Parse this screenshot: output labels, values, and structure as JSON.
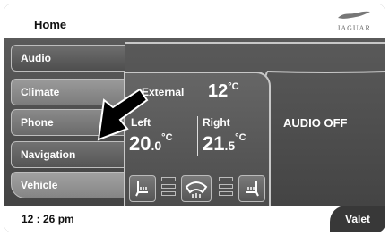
{
  "header": {
    "title": "Home",
    "brand": "JAGUAR"
  },
  "nav": [
    {
      "key": "audio",
      "label": "Audio"
    },
    {
      "key": "climate",
      "label": "Climate"
    },
    {
      "key": "phone",
      "label": "Phone"
    },
    {
      "key": "navigation",
      "label": "Navigation"
    },
    {
      "key": "vehicle",
      "label": "Vehicle"
    }
  ],
  "climate": {
    "external_label": "External",
    "external_value": "12",
    "external_unit": "°C",
    "left_label": "Left",
    "right_label": "Right",
    "left_temp_int": "20",
    "left_temp_dec": ".0",
    "right_temp_int": "21",
    "right_temp_dec": ".5",
    "unit": "°C"
  },
  "audio_status": "AUDIO OFF",
  "footer": {
    "time": "12 : 26 pm",
    "valet_label": "Valet"
  },
  "colors": {
    "panel": "#4a4a4a",
    "outline": "#c8c8c8",
    "text": "#ffffff"
  },
  "icons": [
    "jaguar-leaper-icon",
    "pointer-arrow-icon",
    "seat-heater-icon",
    "defrost-icon"
  ]
}
